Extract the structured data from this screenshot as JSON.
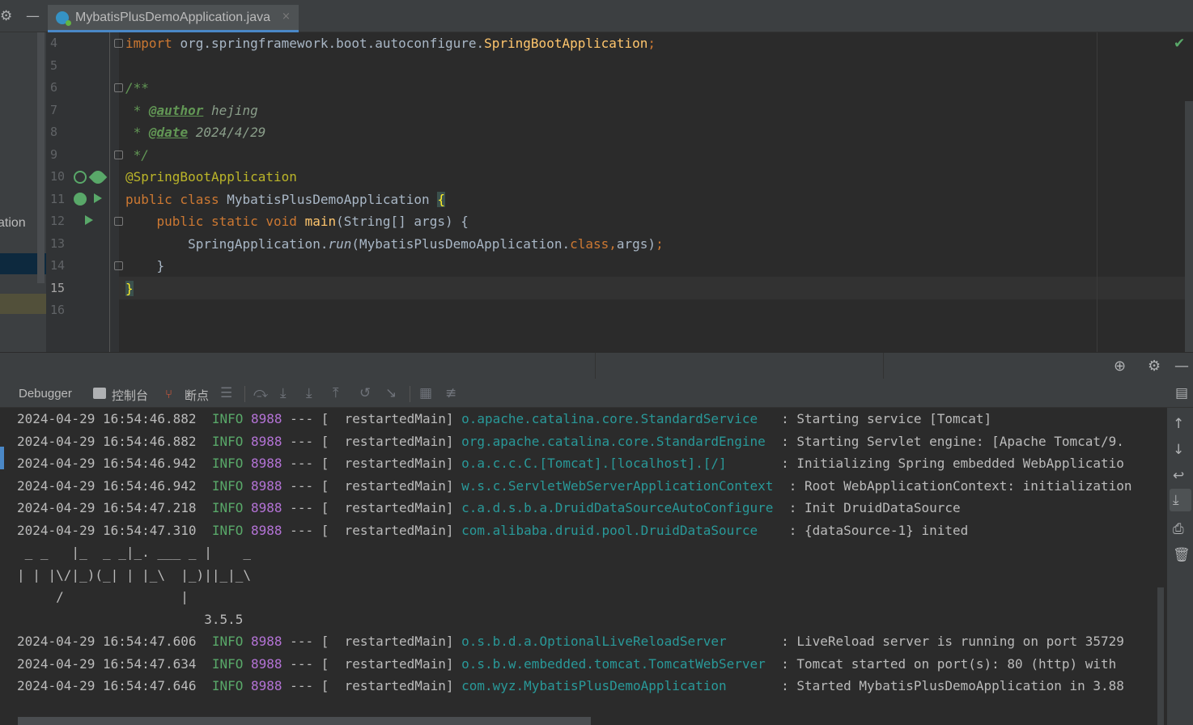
{
  "editor": {
    "tab_label": "MybatisPlusDemoApplication.java",
    "tab_close": "×",
    "project_fragment": "ation",
    "lines": [
      {
        "n": "4",
        "tokens": [
          {
            "t": "import ",
            "c": "kw"
          },
          {
            "t": "org.springframework.boot.autoconfigure.",
            "c": "plain"
          },
          {
            "t": "SpringBootApplication",
            "c": "fn"
          },
          {
            "t": ";",
            "c": "kw"
          }
        ]
      },
      {
        "n": "5",
        "tokens": []
      },
      {
        "n": "6",
        "tokens": [
          {
            "t": "/**",
            "c": "cmt"
          }
        ]
      },
      {
        "n": "7",
        "tokens": [
          {
            "t": " * ",
            "c": "cmt"
          },
          {
            "t": "@author",
            "c": "tag"
          },
          {
            "t": " hejing",
            "c": "tagval"
          }
        ]
      },
      {
        "n": "8",
        "tokens": [
          {
            "t": " * ",
            "c": "cmt"
          },
          {
            "t": "@date",
            "c": "tag"
          },
          {
            "t": " 2024/4/29",
            "c": "tagval"
          }
        ]
      },
      {
        "n": "9",
        "tokens": [
          {
            "t": " */",
            "c": "cmt"
          }
        ]
      },
      {
        "n": "10",
        "tokens": [
          {
            "t": "@SpringBootApplication",
            "c": "ann"
          }
        ]
      },
      {
        "n": "11",
        "tokens": [
          {
            "t": "public class ",
            "c": "kw"
          },
          {
            "t": "MybatisPlusDemoApplication ",
            "c": "plain"
          },
          {
            "t": "{",
            "c": "brace-hl"
          }
        ]
      },
      {
        "n": "12",
        "tokens": [
          {
            "t": "    public static void ",
            "c": "kw"
          },
          {
            "t": "main",
            "c": "fn"
          },
          {
            "t": "(String[] args) {",
            "c": "plain"
          }
        ]
      },
      {
        "n": "13",
        "tokens": [
          {
            "t": "        SpringApplication.",
            "c": "plain"
          },
          {
            "t": "run",
            "c": "italic"
          },
          {
            "t": "(MybatisPlusDemoApplication.",
            "c": "plain"
          },
          {
            "t": "class",
            "c": "kw"
          },
          {
            "t": ",",
            "c": "kw"
          },
          {
            "t": "args)",
            "c": "plain"
          },
          {
            "t": ";",
            "c": "kw"
          }
        ]
      },
      {
        "n": "14",
        "tokens": [
          {
            "t": "    }",
            "c": "plain"
          }
        ]
      },
      {
        "n": "15",
        "tokens": [
          {
            "t": "}",
            "c": "brace-hl"
          }
        ]
      },
      {
        "n": "16",
        "tokens": []
      }
    ],
    "current_line": "15"
  },
  "panel": {
    "tabs": {
      "debugger": "Debugger",
      "console": "控制台",
      "breakpoints": "断点"
    }
  },
  "console": {
    "lines": [
      {
        "ts": "2024-04-29 16:54:46.882",
        "level": "INFO",
        "pid": "8988",
        "sep": " --- [  restartedMain] ",
        "logger": "o.apache.catalina.core.StandardService   ",
        "msg": ": Starting service [Tomcat]"
      },
      {
        "ts": "2024-04-29 16:54:46.882",
        "level": "INFO",
        "pid": "8988",
        "sep": " --- [  restartedMain] ",
        "logger": "org.apache.catalina.core.StandardEngine  ",
        "msg": ": Starting Servlet engine: [Apache Tomcat/9."
      },
      {
        "ts": "2024-04-29 16:54:46.942",
        "level": "INFO",
        "pid": "8988",
        "sep": " --- [  restartedMain] ",
        "logger": "o.a.c.c.C.[Tomcat].[localhost].[/]       ",
        "msg": ": Initializing Spring embedded WebApplicatio"
      },
      {
        "ts": "2024-04-29 16:54:46.942",
        "level": "INFO",
        "pid": "8988",
        "sep": " --- [  restartedMain] ",
        "logger": "w.s.c.ServletWebServerApplicationContext  ",
        "msg": ": Root WebApplicationContext: initialization"
      },
      {
        "ts": "2024-04-29 16:54:47.218",
        "level": "INFO",
        "pid": "8988",
        "sep": " --- [  restartedMain] ",
        "logger": "c.a.d.s.b.a.DruidDataSourceAutoConfigure  ",
        "msg": ": Init DruidDataSource"
      },
      {
        "ts": "2024-04-29 16:54:47.310",
        "level": "INFO",
        "pid": "8988",
        "sep": " --- [  restartedMain] ",
        "logger": "com.alibaba.druid.pool.DruidDataSource    ",
        "msg": ": {dataSource-1} inited"
      }
    ],
    "banner": [
      " _ _   |_  _ _|_. ___ _ |    _ ",
      "| | |\\/|_)(_| | |_\\  |_)||_|_\\ ",
      "     /               |",
      "                        3.5.5 "
    ],
    "lines2": [
      {
        "ts": "2024-04-29 16:54:47.606",
        "level": "INFO",
        "pid": "8988",
        "sep": " --- [  restartedMain] ",
        "logger": "o.s.b.d.a.OptionalLiveReloadServer       ",
        "msg": ": LiveReload server is running on port 35729"
      },
      {
        "ts": "2024-04-29 16:54:47.634",
        "level": "INFO",
        "pid": "8988",
        "sep": " --- [  restartedMain] ",
        "logger": "o.s.b.w.embedded.tomcat.TomcatWebServer  ",
        "msg": ": Tomcat started on port(s): 80 (http) with"
      },
      {
        "ts": "2024-04-29 16:54:47.646",
        "level": "INFO",
        "pid": "8988",
        "sep": " --- [  restartedMain] ",
        "logger": "com.wyz.MybatisPlusDemoApplication       ",
        "msg": ": Started MybatisPlusDemoApplication in 3.88"
      }
    ]
  },
  "icons": {
    "settings": "gear-icon",
    "minimize": "minus-icon",
    "check": "check-icon",
    "target": "crosshair-icon"
  },
  "colors": {
    "accent": "#4a88c7",
    "keyword": "#cc7832",
    "info": "#59a869",
    "logger": "#299999",
    "pid": "#b473d6"
  }
}
